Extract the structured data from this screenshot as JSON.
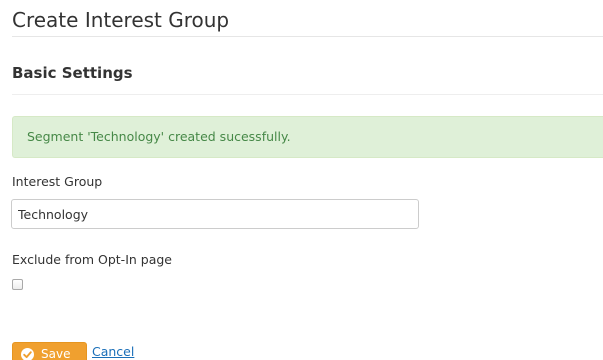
{
  "page": {
    "title": "Create Interest Group"
  },
  "section": {
    "title": "Basic Settings"
  },
  "alert": {
    "message": "Segment 'Technology' created sucessfully."
  },
  "form": {
    "interest_group_label": "Interest Group",
    "interest_group_value": "Technology",
    "exclude_label": "Exclude from Opt-In page",
    "exclude_checked": false
  },
  "actions": {
    "save_label": "Save",
    "save_icon": "check-circle-icon",
    "cancel_label": "Cancel"
  },
  "colors": {
    "alert_bg": "#dff0d8",
    "alert_text": "#468847",
    "save_button": "#f0a02f",
    "link": "#1a6fb8"
  }
}
